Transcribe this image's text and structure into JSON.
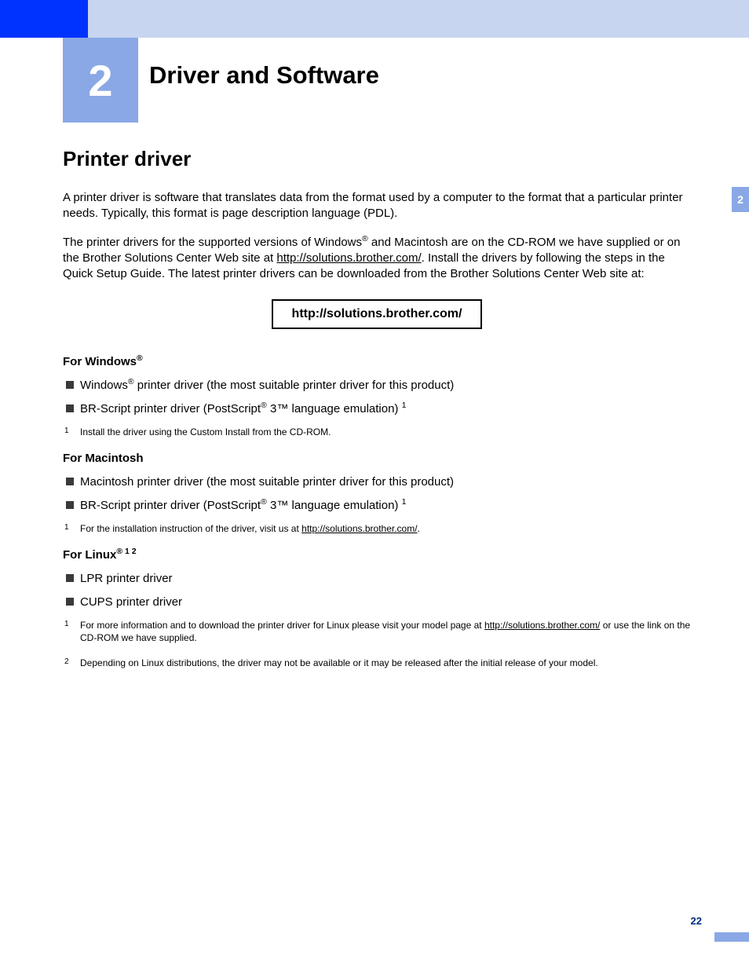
{
  "chapter": {
    "number": "2",
    "title": "Driver and Software"
  },
  "sideTab": "2",
  "pageNumber": "22",
  "section": {
    "title": "Printer driver",
    "para1": "A printer driver is software that translates data from the format used by a computer to the format that a particular printer needs. Typically, this format is page description language (PDL).",
    "para2a": "The printer drivers for the supported versions of Windows",
    "para2b": " and Macintosh are on the CD-ROM we have supplied or on the Brother Solutions Center Web site at ",
    "para2_url": "http://solutions.brother.com/",
    "para2c": ". Install the drivers by following the steps in the Quick Setup Guide. The latest printer drivers can be downloaded from the Brother Solutions Center Web site at:",
    "urlBox": "http://solutions.brother.com/"
  },
  "windows": {
    "heading": "For Windows",
    "item1a": "Windows",
    "item1b": " printer driver (the most suitable printer driver for this product)",
    "item2a": "BR-Script printer driver (PostScript",
    "item2b": " 3™ language emulation) ",
    "fn1_num": "1",
    "fn1": "Install the driver using the Custom Install from the CD-ROM."
  },
  "mac": {
    "heading": "For Macintosh",
    "item1": "Macintosh printer driver (the most suitable printer driver for this product)",
    "item2a": "BR-Script printer driver (PostScript",
    "item2b": " 3™ language emulation) ",
    "fn1_num": "1",
    "fn1a": "For the installation instruction of the driver, visit us at ",
    "fn1_url": "http://solutions.brother.com/",
    "fn1b": "."
  },
  "linux": {
    "heading": "For Linux",
    "sup": " 1 2",
    "item1": "LPR printer driver",
    "item2": "CUPS printer driver",
    "fn1_num": "1",
    "fn1a": "For more information and to download the printer driver for Linux please visit your model page at ",
    "fn1_url": "http://solutions.brother.com/",
    "fn1b": " or use the link on the CD-ROM we have supplied.",
    "fn2_num": "2",
    "fn2": "Depending on Linux distributions, the driver may not be available or it may be released after the initial release of your model."
  }
}
